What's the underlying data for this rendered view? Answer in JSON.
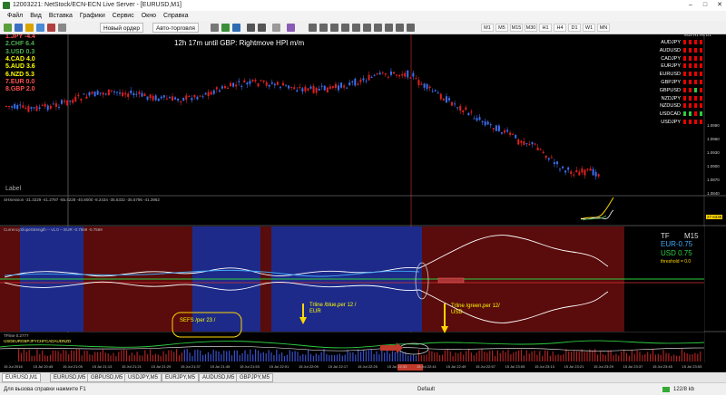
{
  "window": {
    "title": "12003221: NetStock/ECN-ECN Live Server - [EURUSD,M1]"
  },
  "menu": [
    "Файл",
    "Вид",
    "Вставка",
    "Графики",
    "Сервис",
    "Окно",
    "Справка"
  ],
  "toolbar": {
    "new_order": "Новый ордер",
    "autotrade": "Авто-торговля"
  },
  "timeframes": [
    "M1",
    "M5",
    "M15",
    "M30",
    "H1",
    "H4",
    "D1",
    "W1",
    "MN"
  ],
  "chart": {
    "headline": "12h 17m until GBP: Rightmove HPI m/m",
    "label": "Label",
    "currencies": [
      {
        "text": "1.JPY -4.4",
        "color": "#ff5050"
      },
      {
        "text": "2.CHF 6.4",
        "color": "#4caf50"
      },
      {
        "text": "3.USD 0.3",
        "color": "#4caf50"
      },
      {
        "text": "4.CAD 4.0",
        "color": "#ffff00"
      },
      {
        "text": "5.AUD 3.6",
        "color": "#ffff00"
      },
      {
        "text": "6.NZD 5.3",
        "color": "#ffff00"
      },
      {
        "text": "7.EUR 0.0",
        "color": "#ff5050"
      },
      {
        "text": "8.GBP 2.0",
        "color": "#ff5050"
      }
    ],
    "matrix_header": "M15 H1 H4 D1",
    "matrix_pairs": [
      "AUDJPY",
      "AUDUSD",
      "CADJPY",
      "EURJPY",
      "EURUSD",
      "GBPJPY",
      "GBPUSD",
      "NZDJPY",
      "NZDUSD",
      "USDCAD",
      "USDJPY"
    ],
    "matrix_green": [
      [
        0,
        0,
        0,
        0
      ],
      [
        0,
        0,
        0,
        0
      ],
      [
        0,
        0,
        0,
        0
      ],
      [
        0,
        0,
        0,
        0
      ],
      [
        0,
        0,
        0,
        0
      ],
      [
        0,
        0,
        0,
        0
      ],
      [
        0,
        0,
        1,
        0
      ],
      [
        0,
        0,
        0,
        0
      ],
      [
        0,
        0,
        0,
        0
      ],
      [
        1,
        1,
        0,
        1
      ],
      [
        0,
        0,
        0,
        0
      ]
    ],
    "price_scale": [
      "1.0990",
      "1.0960",
      "1.0930",
      "1.0900",
      "1.0870",
      "1.0840"
    ],
    "indicator1": {
      "label": "SHSession -31.3229 -41.2787 -55.4228 -40.8000 -8.2434 -35.6332 -35.5796 -41.3962",
      "scale": "27.6338"
    },
    "indicator2": {
      "label": "CurrencySlopeStrength -- v1.0 -- EUR -0.7569 -0.7569",
      "tf_label": "TF",
      "tf_value": "M15",
      "eur": "EUR-0.75",
      "usd": "USD 0.75",
      "threshold": "threshold = 0.0"
    },
    "indicator3": {
      "label": "TFline 0.2777",
      "sub": "USDEURGBPJPYCHFCADAUDNZD"
    },
    "callouts": {
      "sefs": "SEFS    /per 23 /",
      "blue_line1": "Trline  /blue,per 12 /",
      "blue_line2": "EUR",
      "green_line1": "Trline  /green,per 12/",
      "green_line2": "USD"
    },
    "times": [
      "15 Jul 2016",
      "15 Jul 20:45",
      "15 Jul 21:05",
      "15 Jul 21:13",
      "15 Jul 21:21",
      "15 Jul 21:29",
      "15 Jul 21:37",
      "15 Jul 21:45",
      "15 Jul 21:53",
      "15 Jul 22:01",
      "15 Jul 22:09",
      "15 Jul 22:17",
      "15 Jul 22:25",
      "15 Jul 22:33",
      "15 Jul 22:41",
      "15 Jul 22:49",
      "15 Jul 22:57",
      "15 Jul 23:05",
      "15 Jul 23:13",
      "15 Jul 23:21",
      "15 Jul 23:29",
      "15 Jul 23:37",
      "15 Jul 23:45",
      "15 Jul 23:53"
    ]
  },
  "tabs": [
    "EURUSD,M1",
    "EURUSD,M5",
    "GBPUSD,M5",
    "USDJPY,M5",
    "EURJPY,M5",
    "AUDUSD,M5",
    "GBPJPY,M5"
  ],
  "status": {
    "help": "Для вызова справки нажмите F1",
    "profile": "Default",
    "traffic": "122/8 kb"
  }
}
